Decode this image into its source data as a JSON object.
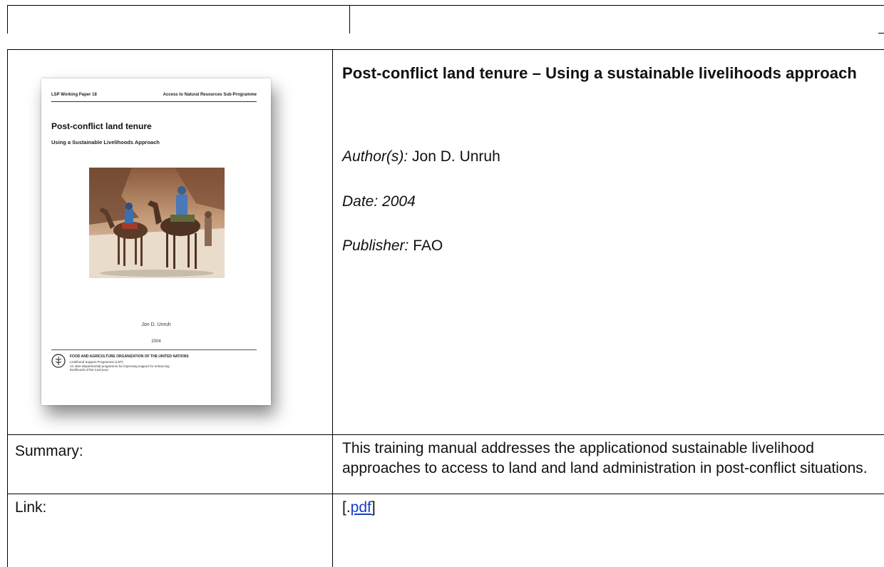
{
  "entry": {
    "title": "Post-conflict land tenure – Using a sustainable livelihoods approach",
    "author_label": "Author(s):",
    "author_value": "Jon D. Unruh",
    "date_text": "Date: 2004",
    "publisher_label": "Publisher:",
    "publisher_value": "FAO"
  },
  "cover": {
    "series": "LSP Working Paper 18",
    "programme": "Access to Natural Resources Sub-Programme",
    "title": "Post-conflict land tenure",
    "subtitle": "Using a Sustainable Livelihoods Approach",
    "author": "Jon D. Unruh",
    "year": "2004",
    "org": "FOOD AND AGRICULTURE ORGANIZATION OF THE UNITED NATIONS",
    "lsp_line1": "Livelihood Support Programme (LSP)",
    "lsp_line2": "An inter-departmental programme for improving support for enhancing",
    "lsp_line3": "livelihoods of the rural poor."
  },
  "summary": {
    "label": "Summary:",
    "text": "This training manual addresses the applicationod sustainable livelihood approaches to access to land and land administration in post-conflict situations."
  },
  "link": {
    "label": "Link:",
    "prefix": "[.",
    "anchor": "pdf",
    "suffix": "]"
  },
  "colors": {
    "link": "#1a3cc8",
    "border": "#000000"
  }
}
